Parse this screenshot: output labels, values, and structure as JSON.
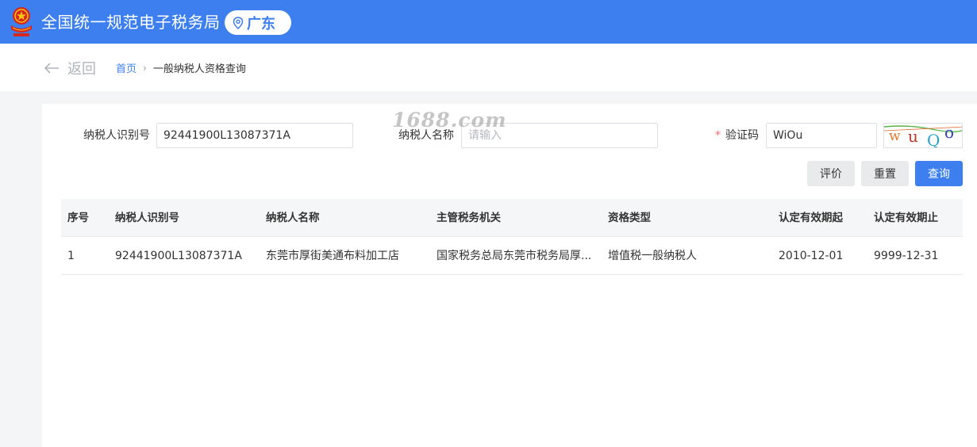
{
  "header": {
    "site_title": "全国统一规范电子税务局",
    "region": "广东"
  },
  "breadcrumb": {
    "back_label": "返回",
    "home": "首页",
    "separator": "›",
    "current": "一般纳税人资格查询"
  },
  "form": {
    "taxpayer_id_label": "纳税人识别号",
    "taxpayer_id_value": "92441900L13087371A",
    "taxpayer_name_label": "纳税人名称",
    "taxpayer_name_placeholder": "请输入",
    "captcha_required_mark": "*",
    "captcha_label": "验证码",
    "captcha_value": "WiOu",
    "captcha_image_text": "wuQo"
  },
  "buttons": {
    "evaluate": "评价",
    "reset": "重置",
    "query": "查询"
  },
  "table": {
    "columns": [
      "序号",
      "纳税人识别号",
      "纳税人名称",
      "主管税务机关",
      "资格类型",
      "认定有效期起",
      "认定有效期止"
    ],
    "rows": [
      [
        "1",
        "92441900L13087371A",
        "东莞市厚街美通布料加工店",
        "国家税务总局东莞市税务局厚...",
        "增值税一般纳税人",
        "2010-12-01",
        "9999-12-31"
      ]
    ]
  },
  "watermark": "1688.com",
  "colors": {
    "header_blue": "#3d7fef",
    "required_red": "#f56c6c",
    "emblem_red": "#d7261e",
    "emblem_gold": "#f3c614"
  }
}
